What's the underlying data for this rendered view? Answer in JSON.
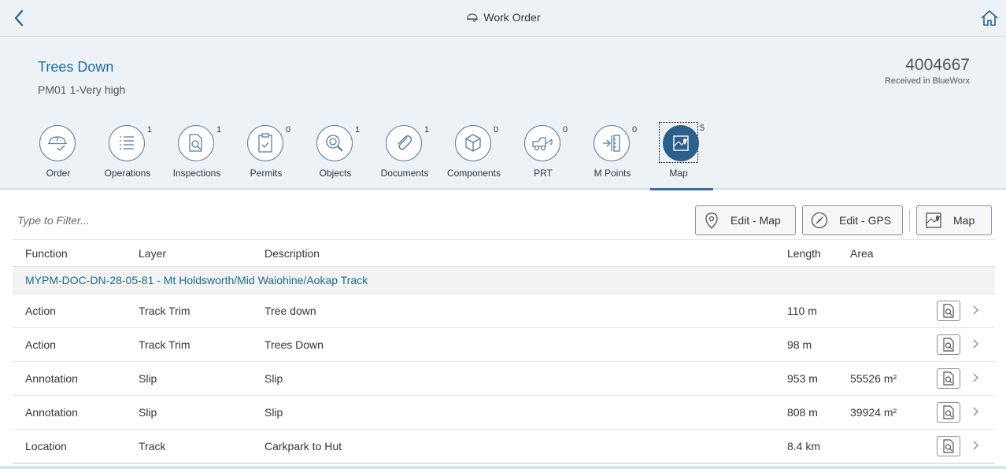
{
  "shell": {
    "title": "Work Order",
    "back_icon": "chevron-left-icon",
    "home_icon": "home-icon"
  },
  "header": {
    "title": "Trees Down",
    "subtitle": "PM01 1-Very high",
    "number": "4004667",
    "status": "Received in BlueWorx"
  },
  "tabs": [
    {
      "label": "Order",
      "count": "",
      "icon": "hard-hat-check-icon"
    },
    {
      "label": "Operations",
      "count": "1",
      "icon": "list-icon"
    },
    {
      "label": "Inspections",
      "count": "1",
      "icon": "document-search-icon"
    },
    {
      "label": "Permits",
      "count": "0",
      "icon": "clipboard-check-icon"
    },
    {
      "label": "Objects",
      "count": "1",
      "icon": "object-search-icon"
    },
    {
      "label": "Documents",
      "count": "1",
      "icon": "paperclip-icon"
    },
    {
      "label": "Components",
      "count": "0",
      "icon": "cube-icon"
    },
    {
      "label": "PRT",
      "count": "0",
      "icon": "tow-truck-icon"
    },
    {
      "label": "M Points",
      "count": "0",
      "icon": "measure-in-icon"
    },
    {
      "label": "Map",
      "count": "5",
      "icon": "map-icon",
      "selected": true
    }
  ],
  "toolbar": {
    "filter_placeholder": "Type to Filter...",
    "edit_map_label": "Edit - Map",
    "edit_gps_label": "Edit - GPS",
    "map_label": "Map"
  },
  "table": {
    "columns": [
      "Function",
      "Layer",
      "Description",
      "Length",
      "Area"
    ],
    "group": "MYPM-DOC-DN-28-05-81 - Mt Holdsworth/Mid Waiohine/Aokap Track",
    "rows": [
      {
        "function": "Action",
        "layer": "Track Trim",
        "description": "Tree down",
        "length": "110 m",
        "area": ""
      },
      {
        "function": "Action",
        "layer": "Track Trim",
        "description": "Trees Down",
        "length": "98 m",
        "area": ""
      },
      {
        "function": "Annotation",
        "layer": "Slip",
        "description": "Slip",
        "length": "953 m",
        "area": "55526 m²"
      },
      {
        "function": "Annotation",
        "layer": "Slip",
        "description": "Slip",
        "length": "808 m",
        "area": "39924 m²"
      },
      {
        "function": "Location",
        "layer": "Track",
        "description": "Carkpark to Hut",
        "length": "8.4 km",
        "area": ""
      }
    ]
  },
  "colors": {
    "shell_bg": "#edf2f7",
    "link": "#1a6bab",
    "selected_tab": "#2c5f8a",
    "group_text": "#1a6d8a"
  }
}
